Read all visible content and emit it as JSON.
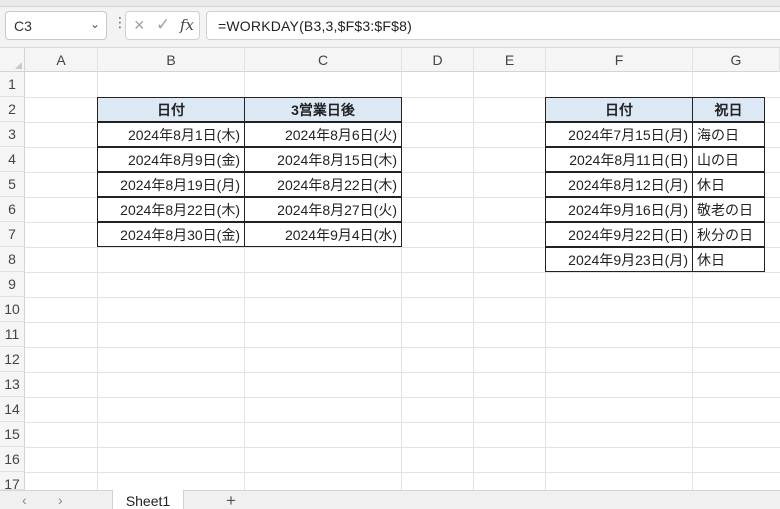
{
  "formula_bar": {
    "name_box": "C3",
    "more_icon": "⋮",
    "cancel_icon": "×",
    "enter_icon": "✓",
    "fx_label": "fx",
    "formula": "=WORKDAY(B3,3,$F$3:$F$8)"
  },
  "columns": [
    "A",
    "B",
    "C",
    "D",
    "E",
    "F",
    "G"
  ],
  "rows": [
    "1",
    "2",
    "3",
    "4",
    "5",
    "6",
    "7",
    "8",
    "9",
    "10",
    "11",
    "12",
    "13",
    "14",
    "15",
    "16",
    "17"
  ],
  "table1": {
    "headers": [
      "日付",
      "3営業日後"
    ],
    "rows": [
      [
        "2024年8月1日(木)",
        "2024年8月6日(火)"
      ],
      [
        "2024年8月9日(金)",
        "2024年8月15日(木)"
      ],
      [
        "2024年8月19日(月)",
        "2024年8月22日(木)"
      ],
      [
        "2024年8月22日(木)",
        "2024年8月27日(火)"
      ],
      [
        "2024年8月30日(金)",
        "2024年9月4日(水)"
      ]
    ]
  },
  "table2": {
    "headers": [
      "日付",
      "祝日"
    ],
    "rows": [
      [
        "2024年7月15日(月)",
        "海の日"
      ],
      [
        "2024年8月11日(日)",
        "山の日"
      ],
      [
        "2024年8月12日(月)",
        "休日"
      ],
      [
        "2024年9月16日(月)",
        "敬老の日"
      ],
      [
        "2024年9月22日(日)",
        "秋分の日"
      ],
      [
        "2024年9月23日(月)",
        "休日"
      ]
    ]
  },
  "sheet_tabs": {
    "prev_icon": "‹",
    "next_icon": "›",
    "active": "Sheet1",
    "add_icon": "+"
  },
  "colors": {
    "header_fill": "#dde8f5",
    "border": "#222222",
    "grid": "#e3e3e3"
  }
}
